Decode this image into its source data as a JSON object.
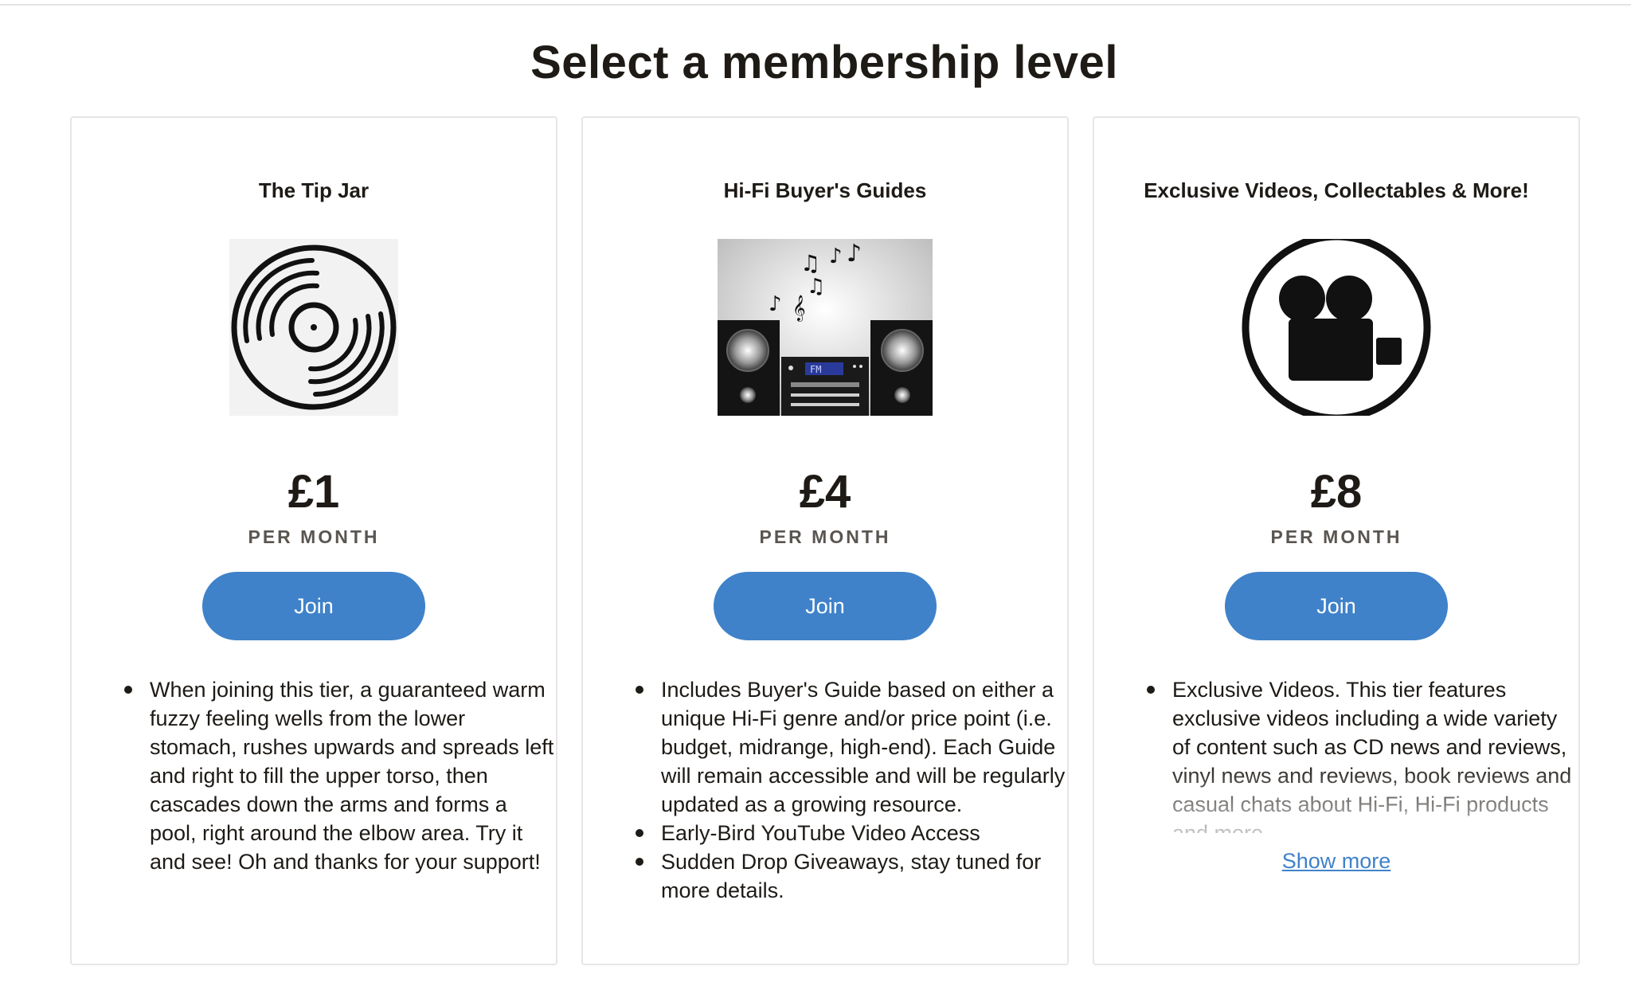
{
  "page": {
    "title": "Select a membership level"
  },
  "colors": {
    "accent": "#3f82c9",
    "text": "#1e1a16",
    "muted": "#5a5550",
    "border": "#e6e6e6"
  },
  "tiers": [
    {
      "name": "The Tip Jar",
      "icon": "vinyl-record-icon",
      "price": "£1",
      "period": "PER MONTH",
      "join_label": "Join",
      "benefits": [
        "When joining this tier, a guaranteed warm fuzzy feeling wells from the lower stomach, rushes upwards and spreads left and right to fill the upper torso, then cascades down the arms and forms a pool, right around the elbow area. Try it and see! Oh and thanks for your support!"
      ]
    },
    {
      "name": "Hi-Fi Buyer's Guides",
      "icon": "stereo-system-icon",
      "display_text": "FM",
      "price": "£4",
      "period": "PER MONTH",
      "join_label": "Join",
      "benefits": [
        "Includes Buyer's Guide based on either a unique Hi-Fi genre and/or price point (i.e. budget, midrange, high-end). Each Guide will remain accessible and will be regularly updated as a growing resource.",
        "Early-Bird YouTube Video Access",
        "Sudden Drop Giveaways, stay tuned for more details."
      ]
    },
    {
      "name": "Exclusive Videos, Collectables & More!",
      "icon": "video-camera-icon",
      "price": "£8",
      "period": "PER MONTH",
      "join_label": "Join",
      "benefits": [
        "Exclusive Videos. This tier features exclusive videos including a wide variety of content such as CD news and reviews, vinyl news and reviews, book reviews and casual chats about Hi-Fi, Hi-Fi products and more."
      ],
      "show_more_label": "Show more"
    }
  ]
}
